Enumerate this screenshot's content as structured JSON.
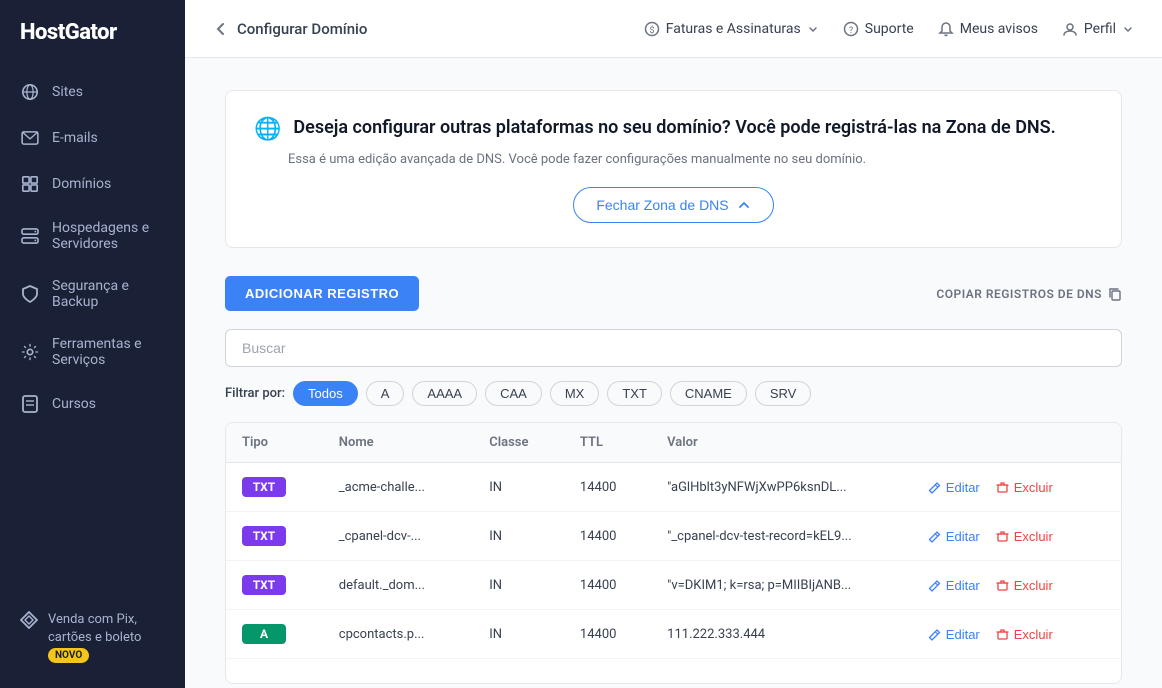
{
  "app": {
    "logo": "HostGator"
  },
  "sidebar": {
    "items": [
      {
        "label": "Sites",
        "icon": "globe-icon"
      },
      {
        "label": "E-mails",
        "icon": "mail-icon"
      },
      {
        "label": "Domínios",
        "icon": "domain-icon"
      },
      {
        "label": "Hospedagens e Servidores",
        "icon": "server-icon"
      },
      {
        "label": "Segurança e Backup",
        "icon": "shield-icon"
      },
      {
        "label": "Ferramentas e Serviços",
        "icon": "tools-icon"
      },
      {
        "label": "Cursos",
        "icon": "book-icon"
      }
    ],
    "bottom": {
      "label": "Venda com Pix, cartões e boleto",
      "badge": "NOVO"
    }
  },
  "topnav": {
    "back_label": "Configurar Domínio",
    "items": [
      {
        "label": "Faturas e Assinaturas",
        "has_chevron": true,
        "icon": "billing-icon"
      },
      {
        "label": "Suporte",
        "icon": "help-icon"
      },
      {
        "label": "Meus avisos",
        "icon": "bell-icon"
      },
      {
        "label": "Perfil",
        "has_chevron": true,
        "icon": "user-icon"
      }
    ]
  },
  "banner": {
    "heading": "Deseja configurar outras plataformas no seu domínio? Você pode registrá-las na Zona de DNS.",
    "subtitle": "Essa é uma edição avançada de DNS. Você pode fazer configurações manualmente no seu domínio.",
    "close_btn": "Fechar Zona de DNS"
  },
  "toolbar": {
    "add_btn": "ADICIONAR REGISTRO",
    "copy_btn": "COPIAR REGISTROS DE DNS"
  },
  "search": {
    "placeholder": "Buscar"
  },
  "filter": {
    "label": "Filtrar por:",
    "options": [
      "Todos",
      "A",
      "AAAA",
      "CAA",
      "MX",
      "TXT",
      "CNAME",
      "SRV"
    ],
    "active": "Todos"
  },
  "table": {
    "columns": [
      "Tipo",
      "Nome",
      "Classe",
      "TTL",
      "Valor"
    ],
    "rows": [
      {
        "type": "TXT",
        "type_class": "type-txt",
        "nome": "_acme-challe...",
        "classe": "IN",
        "ttl": "14400",
        "valor": "\"aGlHblt3yNFWjXwPP6ksnDL..."
      },
      {
        "type": "TXT",
        "type_class": "type-txt",
        "nome": "_cpanel-dcv-...",
        "classe": "IN",
        "ttl": "14400",
        "valor": "\"_cpanel-dcv-test-record=kEL9..."
      },
      {
        "type": "TXT",
        "type_class": "type-txt",
        "nome": "default._dom...",
        "classe": "IN",
        "ttl": "14400",
        "valor": "\"v=DKIM1; k=rsa; p=MIIBIjANB..."
      },
      {
        "type": "A",
        "type_class": "type-a",
        "nome": "cpcontacts.p...",
        "classe": "IN",
        "ttl": "14400",
        "valor": "111.222.333.444"
      }
    ],
    "actions": {
      "edit": "Editar",
      "delete": "Excluir"
    }
  }
}
